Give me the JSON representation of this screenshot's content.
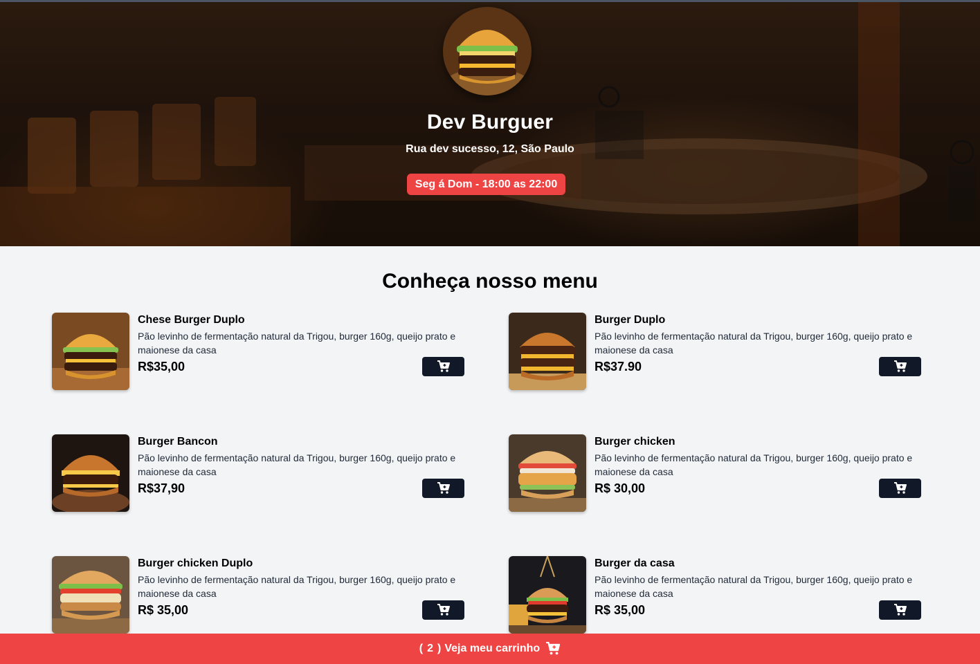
{
  "header": {
    "title": "Dev Burguer",
    "address": "Rua dev sucesso, 12, São Paulo",
    "hours": "Seg á Dom - 18:00 as 22:00"
  },
  "menu": {
    "title": "Conheça nosso menu",
    "items": [
      {
        "name": "Chese Burger Duplo",
        "description": "Pão levinho de fermentação natural da Trigou, burger 160g, queijo prato e maionese da casa",
        "price": "R$35,00"
      },
      {
        "name": "Burger Duplo",
        "description": "Pão levinho de fermentação natural da Trigou, burger 160g, queijo prato e maionese da casa",
        "price": "R$37.90"
      },
      {
        "name": "Burger Bancon",
        "description": "Pão levinho de fermentação natural da Trigou, burger 160g, queijo prato e maionese da casa",
        "price": "R$37,90"
      },
      {
        "name": "Burger chicken",
        "description": "Pão levinho de fermentação natural da Trigou, burger 160g, queijo prato e maionese da casa",
        "price": "R$ 30,00"
      },
      {
        "name": "Burger chicken Duplo",
        "description": "Pão levinho de fermentação natural da Trigou, burger 160g, queijo prato e maionese da casa",
        "price": "R$ 35,00"
      },
      {
        "name": "Burger da casa",
        "description": "Pão levinho de fermentação natural da Trigou, burger 160g, queijo prato e maionese da casa",
        "price": "R$ 35,00"
      }
    ]
  },
  "cart": {
    "open_paren": "(",
    "count": "2",
    "close_paren": ")",
    "label": "Veja meu carrinho",
    "icon": "cart-icon"
  },
  "colors": {
    "accent": "#ef4444",
    "button_dark": "#111827",
    "page_bg": "#f3f4f6"
  }
}
